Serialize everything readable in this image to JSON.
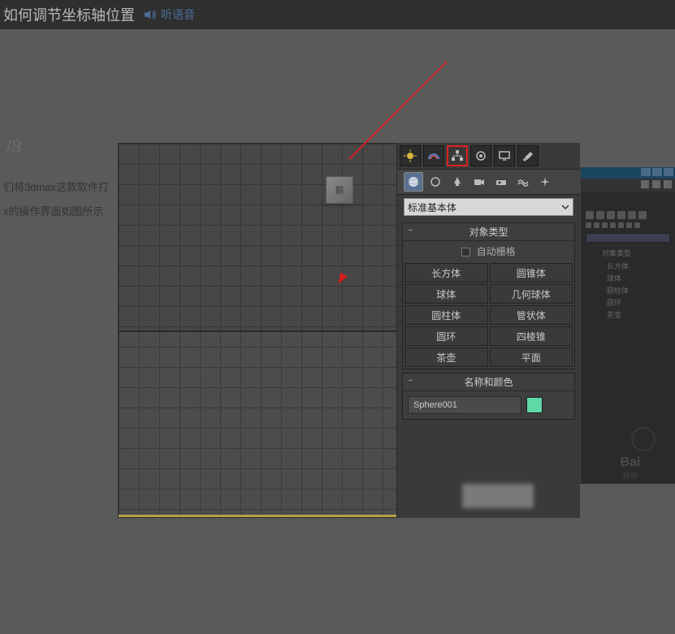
{
  "header": {
    "title": "如何调节坐标轴位置",
    "audio_label": "听语音"
  },
  "step": {
    "current": "",
    "total": "/8"
  },
  "body": {
    "line1": "们将3dmax这款软件打",
    "line2": "x的操作界面如图所示"
  },
  "viewport": {
    "cube_label": "前"
  },
  "panel": {
    "dropdown_value": "标准基本体",
    "rollout1_title": "对象类型",
    "auto_grid_label": "自动栅格",
    "buttons": [
      [
        "长方体",
        "圆锥体"
      ],
      [
        "球体",
        "几何球体"
      ],
      [
        "圆柱体",
        "管状体"
      ],
      [
        "圆环",
        "四棱锥"
      ],
      [
        "茶壶",
        "平面"
      ]
    ],
    "rollout2_title": "名称和颜色",
    "object_name": "Sphere001"
  },
  "watermark": {
    "logo": "Bai",
    "sub": "经验"
  }
}
